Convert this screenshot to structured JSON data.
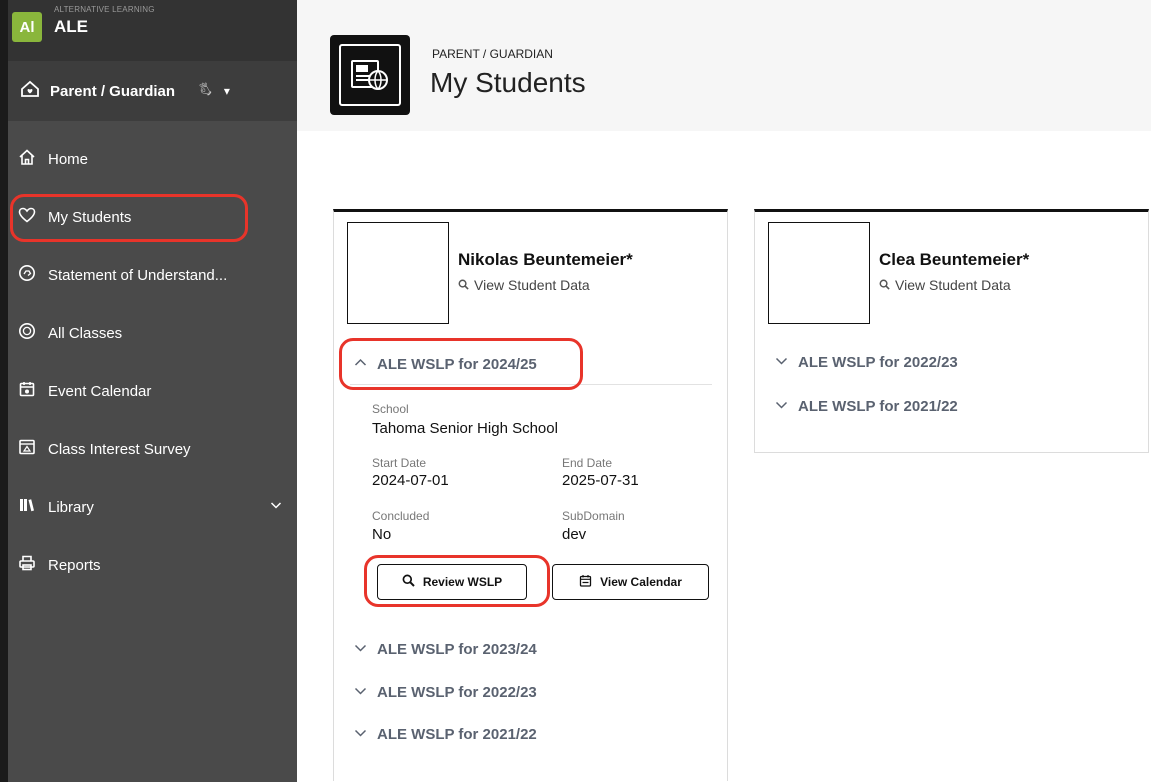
{
  "brand": {
    "logo": "Al",
    "subtitle": "ALTERNATIVE LEARNING",
    "name": "ALE"
  },
  "role": {
    "label": "Parent / Guardian",
    "extra": "🖏︎",
    "caret": "▾"
  },
  "nav": {
    "items": [
      {
        "label": "Home",
        "icon": "home-icon"
      },
      {
        "label": "My Students",
        "icon": "heart-icon"
      },
      {
        "label": "Statement of Understand...",
        "icon": "handshake-icon"
      },
      {
        "label": "All Classes",
        "icon": "classes-icon"
      },
      {
        "label": "Event Calendar",
        "icon": "calendar-icon"
      },
      {
        "label": "Class Interest Survey",
        "icon": "survey-icon"
      },
      {
        "label": "Library",
        "icon": "library-icon"
      },
      {
        "label": "Reports",
        "icon": "printer-icon"
      }
    ]
  },
  "header": {
    "kicker": "PARENT / GUARDIAN",
    "title": "My Students"
  },
  "students": [
    {
      "name": "Nikolas Beuntemeier*",
      "view_data": "View Student Data",
      "expanded_year": "ALE WSLP for 2024/25",
      "details": {
        "school_label": "School",
        "school_value": "Tahoma Senior High School",
        "start_label": "Start Date",
        "start_value": "2024-07-01",
        "end_label": "End Date",
        "end_value": "2025-07-31",
        "concluded_label": "Concluded",
        "concluded_value": "No",
        "subdomain_label": "SubDomain",
        "subdomain_value": "dev"
      },
      "review_button": "Review WSLP",
      "calendar_button": "View Calendar",
      "collapsed_years": [
        "ALE WSLP for 2023/24",
        "ALE WSLP for 2022/23",
        "ALE WSLP for 2021/22"
      ]
    },
    {
      "name": "Clea Beuntemeier*",
      "view_data": "View Student Data",
      "collapsed_years": [
        "ALE WSLP for 2022/23",
        "ALE WSLP for 2021/22"
      ]
    }
  ],
  "colors": {
    "sidebar": "#4a4a4a",
    "brand_green": "#8ab63c",
    "highlight": "#e8342a",
    "year_text": "#5a6270"
  }
}
